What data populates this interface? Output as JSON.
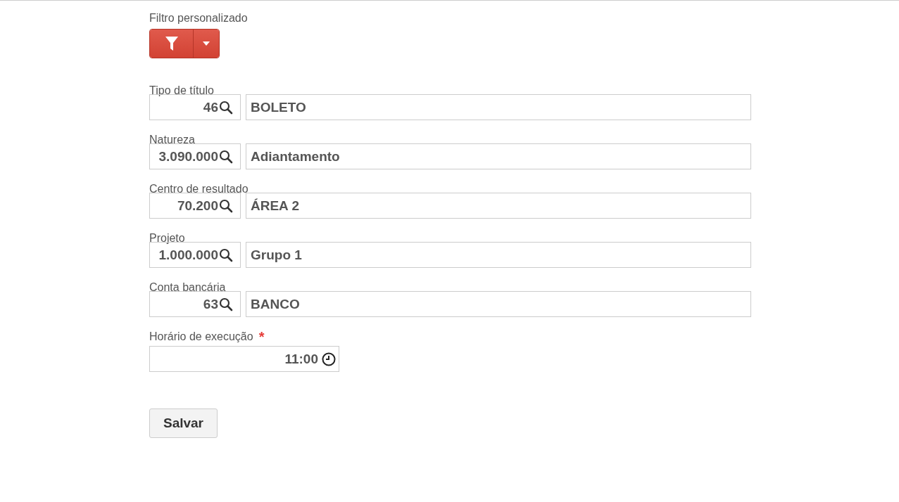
{
  "filter": {
    "label": "Filtro personalizado"
  },
  "lookups": [
    {
      "label": "Tipo de título",
      "code": "46",
      "description": "BOLETO"
    },
    {
      "label": "Natureza",
      "code": "3.090.000",
      "description": "Adiantamento"
    },
    {
      "label": "Centro de resultado",
      "code": "70.200",
      "description": "ÁREA 2"
    },
    {
      "label": "Projeto",
      "code": "1.000.000",
      "description": "Grupo 1"
    },
    {
      "label": "Conta bancária",
      "code": "63",
      "description": "BANCO"
    }
  ],
  "schedule": {
    "label": "Horário de execução",
    "required_mark": "*",
    "value": "11:00"
  },
  "buttons": [
    "Salvar"
  ]
}
